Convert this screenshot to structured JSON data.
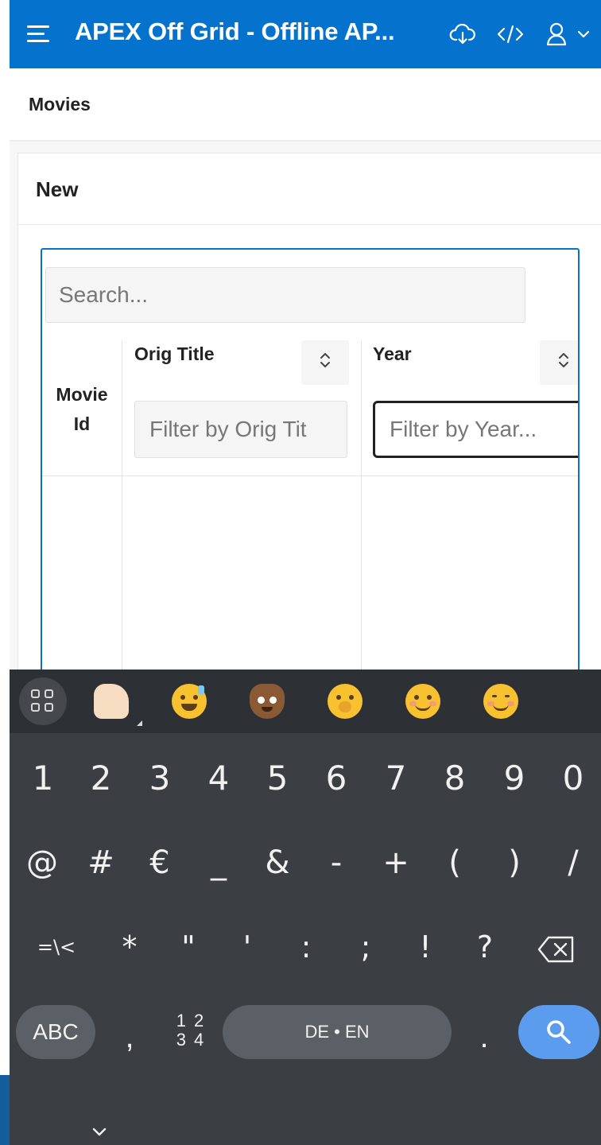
{
  "app": {
    "title": "APEX Off Grid - Offline AP...",
    "icons": [
      "menu-icon",
      "cloud-download-icon",
      "code-icon",
      "user-icon",
      "chevron-down-icon"
    ]
  },
  "breadcrumb": {
    "title": "Movies"
  },
  "region": {
    "title": "New",
    "search_placeholder": "Search...",
    "columns": [
      {
        "label": "Movie Id",
        "sortable": false
      },
      {
        "label": "Orig Title",
        "sortable": true,
        "filter_placeholder": "Filter by Orig Tit"
      },
      {
        "label": "Year",
        "sortable": true,
        "filter_placeholder": "Filter by Year...",
        "focused": true
      }
    ]
  },
  "keyboard": {
    "emojis": [
      "thumbs-up",
      "grinning-sweat",
      "pile-of-poo",
      "yawning-face",
      "smiling-face",
      "smiling-face-with-smiling-eyes"
    ],
    "row1": [
      "1",
      "2",
      "3",
      "4",
      "5",
      "6",
      "7",
      "8",
      "9",
      "0"
    ],
    "row2": [
      "@",
      "#",
      "€",
      "_",
      "&",
      "-",
      "+",
      "(",
      ")",
      "/"
    ],
    "row3": [
      "=\\<",
      "*",
      "\"",
      "'",
      ":",
      ";",
      "!",
      "?"
    ],
    "abc_label": "ABC",
    "comma_label": ",",
    "numpad_label_top": "1 2",
    "numpad_label_bottom": "3 4",
    "space_label": "DE • EN",
    "period_label": ".",
    "colors": {
      "background": "#3b3e42",
      "emoji_bar": "#2d3034",
      "key_pill": "#5b6066",
      "action": "#5b9cef"
    }
  },
  "colors": {
    "brand": "#0572ce",
    "grid_focus": "#0572ce"
  }
}
